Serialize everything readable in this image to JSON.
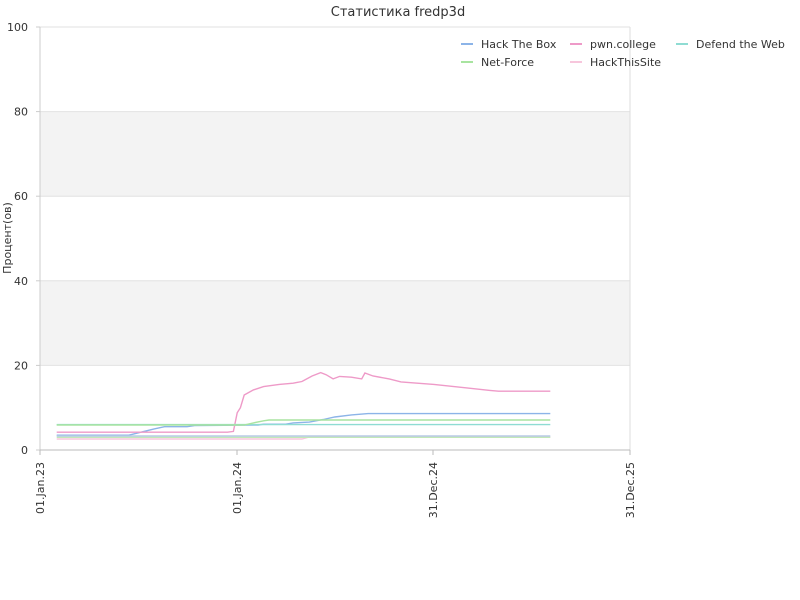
{
  "chart_data": {
    "type": "line",
    "title": "Статистика fredp3d",
    "xlabel": "",
    "ylabel": "Процент(ов)",
    "x_ticks": [
      "01.Jan.23",
      "01.Jan.24",
      "31.Dec.24",
      "31.Dec.25"
    ],
    "y_ticks": [
      "0",
      "20",
      "40",
      "60",
      "80",
      "100"
    ],
    "xlim": [
      "2023-01-01",
      "2025-12-31"
    ],
    "ylim": [
      0,
      100
    ],
    "grid": "horizontal alternating bands",
    "legend_position": "top-right",
    "series": [
      {
        "name": "Hack The Box",
        "color": "#8cb4e8",
        "points": [
          [
            "2023-02-01",
            3.5
          ],
          [
            "2023-06-15",
            3.5
          ],
          [
            "2023-07-10",
            4.3
          ],
          [
            "2023-08-01",
            5.0
          ],
          [
            "2023-08-20",
            5.5
          ],
          [
            "2023-10-01",
            5.5
          ],
          [
            "2023-10-15",
            5.8
          ],
          [
            "2024-02-10",
            5.9
          ],
          [
            "2024-02-20",
            6.1
          ],
          [
            "2024-04-01",
            6.1
          ],
          [
            "2024-04-15",
            6.4
          ],
          [
            "2024-05-15",
            6.6
          ],
          [
            "2024-06-10",
            7.2
          ],
          [
            "2024-07-01",
            7.8
          ],
          [
            "2024-08-01",
            8.3
          ],
          [
            "2024-09-01",
            8.6
          ],
          [
            "2025-08-05",
            8.6
          ]
        ]
      },
      {
        "name": "pwn.college",
        "color": "#ee9ac8",
        "points": [
          [
            "2023-02-01",
            4.2
          ],
          [
            "2023-12-15",
            4.2
          ],
          [
            "2023-12-26",
            4.4
          ],
          [
            "2024-01-02",
            8.8
          ],
          [
            "2024-01-08",
            10.0
          ],
          [
            "2024-01-15",
            13.0
          ],
          [
            "2024-02-01",
            14.2
          ],
          [
            "2024-02-20",
            15.0
          ],
          [
            "2024-03-20",
            15.5
          ],
          [
            "2024-04-15",
            15.8
          ],
          [
            "2024-05-01",
            16.2
          ],
          [
            "2024-05-20",
            17.5
          ],
          [
            "2024-06-05",
            18.3
          ],
          [
            "2024-06-15",
            17.8
          ],
          [
            "2024-06-28",
            16.8
          ],
          [
            "2024-07-10",
            17.4
          ],
          [
            "2024-08-01",
            17.2
          ],
          [
            "2024-08-20",
            16.8
          ],
          [
            "2024-08-26",
            18.2
          ],
          [
            "2024-09-10",
            17.5
          ],
          [
            "2024-10-10",
            16.8
          ],
          [
            "2024-11-01",
            16.1
          ],
          [
            "2025-01-01",
            15.5
          ],
          [
            "2025-03-01",
            14.7
          ],
          [
            "2025-04-15",
            14.1
          ],
          [
            "2025-05-01",
            13.9
          ],
          [
            "2025-08-05",
            13.9
          ]
        ]
      },
      {
        "name": "Defend the Web",
        "color": "#8fdcd3",
        "points": [
          [
            "2023-02-01",
            6.0
          ],
          [
            "2025-08-05",
            6.0
          ]
        ]
      },
      {
        "name": "Net-Force",
        "color": "#a8e4a0",
        "points": [
          [
            "2023-02-01",
            5.9
          ],
          [
            "2024-01-15",
            5.9
          ],
          [
            "2024-02-01",
            6.4
          ],
          [
            "2024-02-20",
            6.9
          ],
          [
            "2024-03-01",
            7.1
          ],
          [
            "2025-08-05",
            7.1
          ]
        ]
      },
      {
        "name": "HackThisSite",
        "color": "#f7c6dc",
        "points": [
          [
            "2023-02-01",
            2.6
          ],
          [
            "2024-05-01",
            2.6
          ],
          [
            "2024-05-15",
            3.1
          ],
          [
            "2025-08-05",
            3.1
          ]
        ]
      },
      {
        "name": "",
        "color": "#c2e8b8",
        "points": [
          [
            "2023-02-01",
            3.0
          ],
          [
            "2025-08-05",
            3.0
          ]
        ]
      },
      {
        "name": "",
        "color": "#b8cbe6",
        "points": [
          [
            "2023-02-01",
            3.3
          ],
          [
            "2025-08-05",
            3.3
          ]
        ]
      }
    ]
  }
}
